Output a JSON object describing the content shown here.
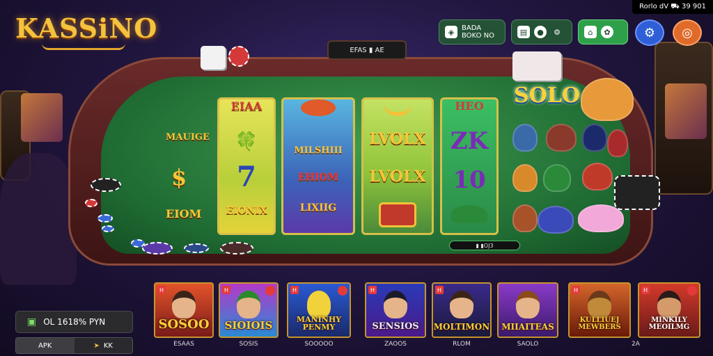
{
  "corner_stat": "Rorlo dV ⛟ 39 901",
  "logo": "KASSiNO",
  "top_buttons": [
    {
      "label": "BADA\nBOKO NO",
      "icon": "tag-icon"
    },
    {
      "label": "",
      "icon": "chat-icon"
    },
    {
      "label": "",
      "icon": "shop-icon"
    }
  ],
  "settings_icon": "gear-icon",
  "profile_icon": "user-icon",
  "table_display": "EFAS ▮ AE",
  "reels": [
    {
      "symbols": [
        "EIAA",
        "🍀",
        "7",
        "EIONIX"
      ]
    },
    {
      "symbols": [
        "",
        "MILSHIII",
        "EHIOM",
        "LIXIIG"
      ]
    },
    {
      "symbols": [
        "",
        "LVOLX",
        "LVOLX",
        ""
      ]
    },
    {
      "symbols": [
        "HEO",
        "ZK",
        "10",
        ""
      ]
    }
  ],
  "left_labels": [
    "MAUIGE",
    "$",
    "EIOM"
  ],
  "solo_label": "SOLO",
  "table_bar": "▮ ▮OJ3",
  "panel_info": {
    "label": "OL 1618% PYN",
    "icon": "wallet-icon"
  },
  "panel_buttons": {
    "apk": "APK",
    "k": "KK"
  },
  "games": [
    {
      "title": "SOSOO",
      "sub": "ESAAS"
    },
    {
      "title": "SIOIOIS",
      "sub": "SOSIS"
    },
    {
      "title": "MANINHY PENMY",
      "sub": "SOOOOO"
    },
    {
      "title": "SENSIOS",
      "sub": "ZAOOS"
    },
    {
      "title": "MOLTIMON",
      "sub": "RLOM"
    },
    {
      "title": "MIIAITEAS",
      "sub": "SAOLO"
    },
    {
      "title": "KULLIUEJ MEWBERS",
      "sub": ""
    },
    {
      "title": "MINKILY MEOILMG",
      "sub": "2A"
    }
  ],
  "colors": {
    "accent_gold": "#f6c638",
    "felt": "#1f6b33",
    "settings": "#2f5fd6",
    "profile": "#e06a2a"
  }
}
